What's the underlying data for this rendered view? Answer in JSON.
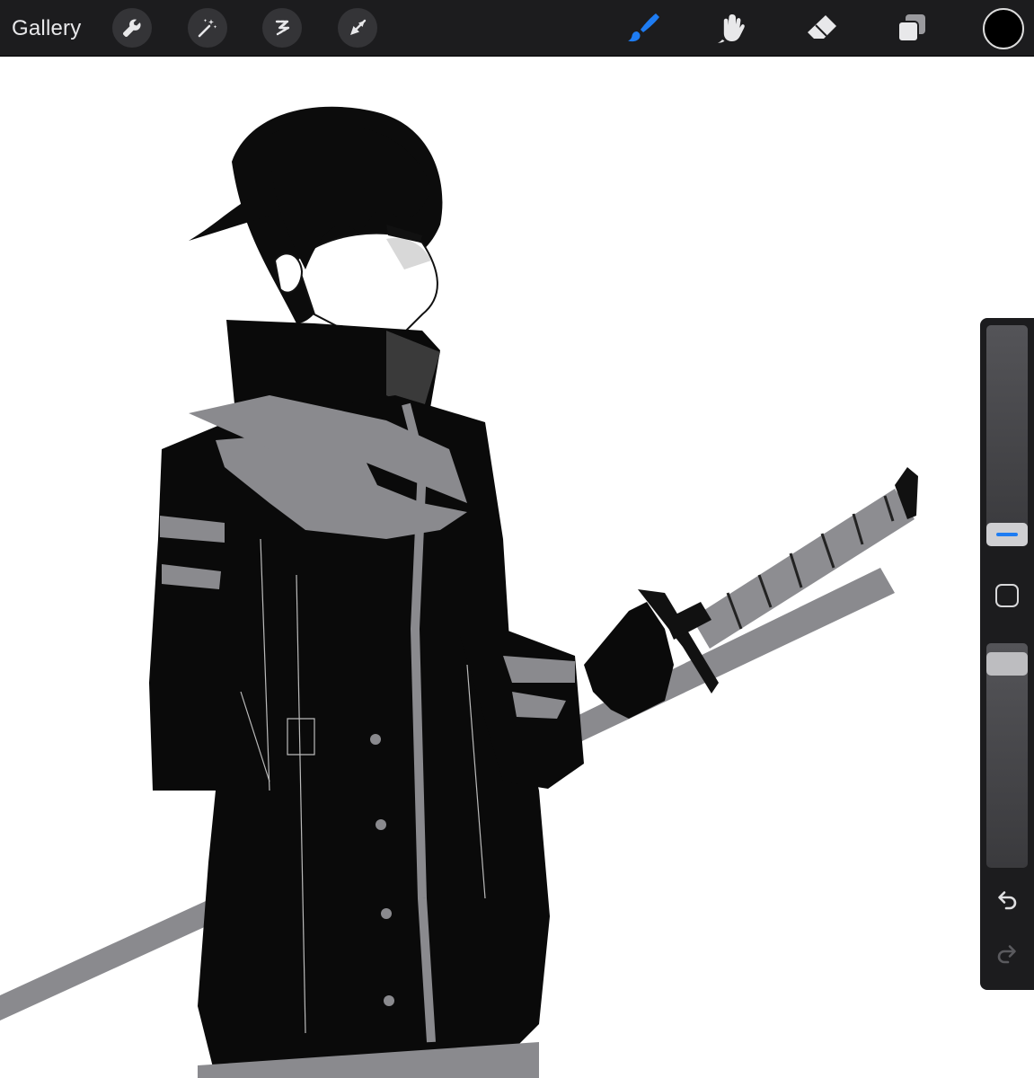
{
  "toolbar": {
    "gallery_label": "Gallery",
    "left_tools": [
      {
        "name": "actions",
        "icon": "wrench-icon"
      },
      {
        "name": "adjustments",
        "icon": "magic-wand-icon"
      },
      {
        "name": "selection",
        "icon": "selection-s-icon"
      },
      {
        "name": "transform",
        "icon": "arrow-cursor-icon"
      }
    ],
    "right_tools": [
      {
        "name": "brush",
        "icon": "brush-icon",
        "active": true
      },
      {
        "name": "smudge",
        "icon": "smudge-icon"
      },
      {
        "name": "eraser",
        "icon": "eraser-icon"
      },
      {
        "name": "layers",
        "icon": "layers-icon"
      }
    ],
    "current_color": "#000000",
    "accent_color": "#1e7cf2"
  },
  "sidebar": {
    "tools": [
      {
        "name": "brush-size-slider"
      },
      {
        "name": "modify-button",
        "icon": "square-icon"
      },
      {
        "name": "opacity-slider"
      },
      {
        "name": "undo",
        "icon": "undo-icon"
      },
      {
        "name": "redo",
        "icon": "redo-icon",
        "enabled": false
      }
    ]
  }
}
